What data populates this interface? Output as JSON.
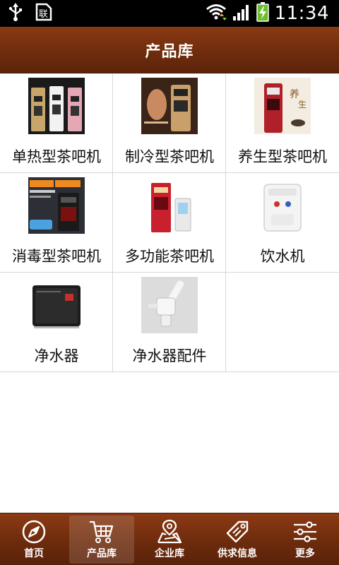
{
  "status_bar": {
    "time": "11:34",
    "icons": [
      "usb-icon",
      "sim-card-icon",
      "wifi-icon",
      "signal-icon",
      "battery-charging-icon"
    ]
  },
  "header": {
    "title": "产品库"
  },
  "products": [
    {
      "label": "单热型茶吧机",
      "thumb": "water-dispensers-trio"
    },
    {
      "label": "制冷型茶吧机",
      "thumb": "gold-tea-bar-machine"
    },
    {
      "label": "养生型茶吧机",
      "thumb": "red-health-tea-machine"
    },
    {
      "label": "消毒型茶吧机",
      "thumb": "dark-promo-tea-machine"
    },
    {
      "label": "多功能茶吧机",
      "thumb": "red-multifunction-machine"
    },
    {
      "label": "饮水机",
      "thumb": "white-desktop-water-dispenser"
    },
    {
      "label": "净水器",
      "thumb": "black-water-purifier"
    },
    {
      "label": "净水器配件",
      "thumb": "purifier-accessory"
    }
  ],
  "bottom_nav": {
    "items": [
      {
        "label": "首页",
        "icon": "compass-icon",
        "active": false
      },
      {
        "label": "产品库",
        "icon": "cart-icon",
        "active": true
      },
      {
        "label": "企业库",
        "icon": "map-icon",
        "active": false
      },
      {
        "label": "供求信息",
        "icon": "tag-icon",
        "active": false
      },
      {
        "label": "更多",
        "icon": "sliders-icon",
        "active": false
      }
    ]
  },
  "colors": {
    "header_brown": "#6f2c0d",
    "nav_brown": "#6b2a0c",
    "grid_border": "#d6d6d6"
  }
}
